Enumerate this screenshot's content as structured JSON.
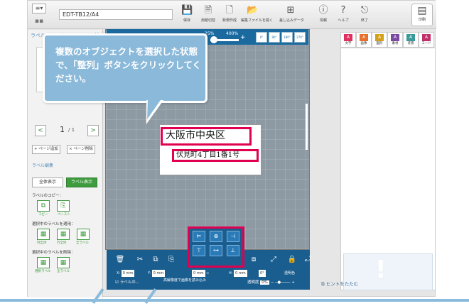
{
  "topbar": {
    "menu_icon": "≡▾",
    "grid_icon": "▪▪",
    "filename": "EDT-TB12/A4",
    "tools": [
      {
        "icon": "save-icon",
        "label": "保存"
      },
      {
        "icon": "print-preview-icon",
        "label": "用紙切替"
      },
      {
        "icon": "new-file-icon",
        "label": "新規作成"
      },
      {
        "icon": "open-edit-file-icon",
        "label": "編集ファイルを開く"
      },
      {
        "icon": "merge-data-icon",
        "label": "差し込みデータ"
      },
      {
        "icon": "info-icon",
        "label": "情報"
      },
      {
        "icon": "help-icon",
        "label": "ヘルプ"
      },
      {
        "icon": "exit-icon",
        "label": "終了"
      }
    ],
    "print_label": "印刷"
  },
  "left_panel": {
    "title": "ラベルレイアウト",
    "close": "×",
    "pager": {
      "current": "1",
      "total": "/ 1",
      "prev": "<",
      "next": ">"
    },
    "page_add": "+ ページ追加",
    "page_delete": "× ページ削除",
    "label_edit": "ラベル編集",
    "view_all": "全体表示",
    "view_label": "ラベル表示",
    "copy_label": "ラベルのコピー：",
    "copy_btn": "コピー",
    "paste_btn": "ペースト",
    "apply_label": "選択中のラベルを適用：",
    "apply_all": "列全体",
    "apply_row": "行全体",
    "apply_full": "全ラベル",
    "delete_label": "選択中のラベルを削除：",
    "delete_selected": "選択ラベル",
    "delete_all": "全ラベル"
  },
  "zoom": {
    "min": "25%",
    "max": "400%",
    "plus": "+",
    "buttons": [
      "0°",
      "90°",
      "180°",
      "270°"
    ]
  },
  "label_card": {
    "line1": "大阪市中央区",
    "line2": "伏見町4丁目1番1号"
  },
  "bubble": {
    "text": "複数のオブジェクトを選択した状態で、「整列」ボタンをクリックしてください。"
  },
  "right_tabs": [
    {
      "label": "文字",
      "color": "#e03060"
    },
    {
      "label": "画像",
      "color": "#e8702a"
    },
    {
      "label": "図形",
      "color": "#d4a017"
    },
    {
      "label": "素材",
      "color": "#7a4aa0"
    },
    {
      "label": "背景",
      "color": "#3a9a9a"
    },
    {
      "label": "コード",
      "color": "#c0306a"
    }
  ],
  "hint": {
    "label": "ヒントをたたむ",
    "icon": "!"
  },
  "bottom": {
    "x_label": "X:",
    "x_value": "0 mm",
    "y_label": "Y:",
    "y_value": "0 mm",
    "w_value": "0 mm",
    "h_label": "H:",
    "h_value": "0 mm",
    "angle": "0°",
    "transparent": "透明色",
    "label_check": "ラベルの...",
    "hires": "高解像度で画像を読み込み",
    "transparency": "透明度",
    "transparency_value": "0%"
  },
  "align_buttons": [
    "⊨",
    "⊕",
    "⊣",
    "⊤",
    "⊶",
    "⊥"
  ]
}
